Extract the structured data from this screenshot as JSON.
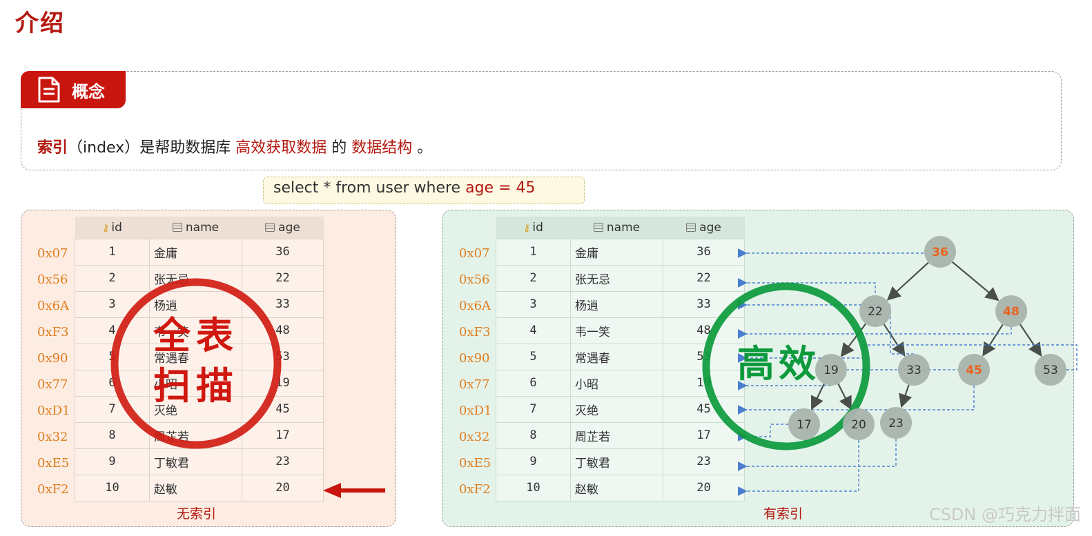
{
  "page_title": "介绍",
  "concept": {
    "tab_label": "概念",
    "tab_icon": "document-icon",
    "sentence": {
      "term": "索引",
      "term_en": "（index）",
      "middle": "是帮助数据库",
      "highlight1": "高效获取数据",
      "connector": "的",
      "highlight2": "数据结构",
      "end": "。"
    }
  },
  "sql": {
    "prefix": "select * from user where ",
    "condition": "age = 45"
  },
  "table": {
    "columns": [
      "id",
      "name",
      "age"
    ],
    "rows": [
      {
        "addr": "0x07",
        "id": "1",
        "name": "金庸",
        "age": "36"
      },
      {
        "addr": "0x56",
        "id": "2",
        "name": "张无忌",
        "age": "22"
      },
      {
        "addr": "0x6A",
        "id": "3",
        "name": "杨逍",
        "age": "33"
      },
      {
        "addr": "0xF3",
        "id": "4",
        "name": "韦一笑",
        "age": "48"
      },
      {
        "addr": "0x90",
        "id": "5",
        "name": "常遇春",
        "age": "53"
      },
      {
        "addr": "0x77",
        "id": "6",
        "name": "小昭",
        "age": "19"
      },
      {
        "addr": "0xD1",
        "id": "7",
        "name": "灭绝",
        "age": "45"
      },
      {
        "addr": "0x32",
        "id": "8",
        "name": "周芷若",
        "age": "17"
      },
      {
        "addr": "0xE5",
        "id": "9",
        "name": "丁敏君",
        "age": "23"
      },
      {
        "addr": "0xF2",
        "id": "10",
        "name": "赵敏",
        "age": "20"
      }
    ]
  },
  "left_panel": {
    "caption": "无索引",
    "stamp_line1": "全表",
    "stamp_line2": "扫描"
  },
  "right_panel": {
    "caption": "有索引",
    "stamp_text": "高效"
  },
  "tree_nodes": {
    "n36": "36",
    "n22": "22",
    "n48": "48",
    "n19": "19",
    "n33": "33",
    "n45": "45",
    "n53": "53",
    "n17": "17",
    "n20": "20",
    "n23": "23"
  },
  "watermark": "CSDN @巧克力拌面",
  "colors": {
    "title_red": "#b4170f",
    "address_orange": "#e07d1d",
    "stamp_red": "#d01810",
    "stamp_green": "#0c9a3c",
    "tree_node_gray": "#a9b3ad",
    "highlight_node_text": "#e8641e",
    "pointer_blue": "#4a7fcf"
  }
}
